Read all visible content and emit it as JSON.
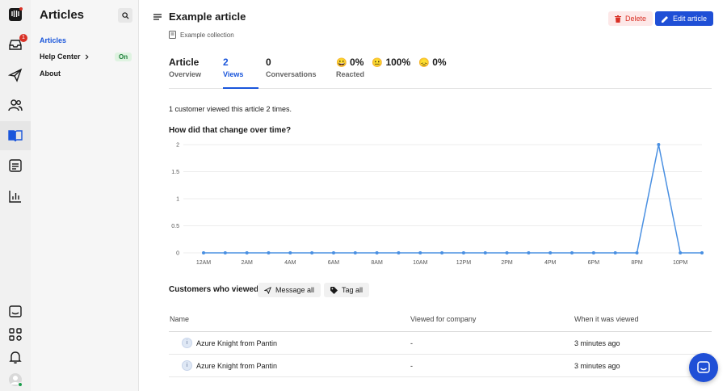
{
  "rail": {
    "inbox_badge": "1"
  },
  "subnav": {
    "title": "Articles",
    "items": [
      {
        "label": "Articles",
        "active": true
      },
      {
        "label": "Help Center",
        "status": "On"
      },
      {
        "label": "About"
      }
    ]
  },
  "article": {
    "title": "Example article",
    "collection": "Example collection",
    "delete_label": "Delete",
    "edit_label": "Edit article"
  },
  "tabs": [
    {
      "value": "Article",
      "label": "Overview"
    },
    {
      "value": "2",
      "label": "Views"
    },
    {
      "value": "0",
      "label": "Conversations"
    }
  ],
  "reactions": {
    "items": [
      {
        "emoji": "😀",
        "percent": "0%"
      },
      {
        "emoji": "😐",
        "percent": "100%"
      },
      {
        "emoji": "😞",
        "percent": "0%"
      }
    ],
    "label": "Reacted"
  },
  "summary": "1 customer viewed this article 2 times.",
  "chart_question": "How did that change over time?",
  "chart_data": {
    "type": "line",
    "x": [
      "12AM",
      "1AM",
      "2AM",
      "3AM",
      "4AM",
      "5AM",
      "6AM",
      "7AM",
      "8AM",
      "9AM",
      "10AM",
      "11AM",
      "12PM",
      "1PM",
      "2PM",
      "3PM",
      "4PM",
      "5PM",
      "6PM",
      "7PM",
      "8PM",
      "9PM",
      "10PM",
      "11PM"
    ],
    "x_tick_labels": [
      "12AM",
      "2AM",
      "4AM",
      "6AM",
      "8AM",
      "10AM",
      "12PM",
      "2PM",
      "4PM",
      "6PM",
      "8PM",
      "10PM"
    ],
    "y_tick_labels": [
      "2",
      "1.5",
      "1",
      "0.5",
      "0"
    ],
    "series": [
      {
        "values": [
          0,
          0,
          0,
          0,
          0,
          0,
          0,
          0,
          0,
          0,
          0,
          0,
          0,
          0,
          0,
          0,
          0,
          0,
          0,
          0,
          0,
          2,
          0,
          0
        ]
      }
    ],
    "ylim": [
      0,
      2
    ],
    "grid": true,
    "color": "#4a90e2"
  },
  "viewers": {
    "heading": "Customers who viewed",
    "message_all": "Message all",
    "tag_all": "Tag all",
    "columns": [
      "Name",
      "Viewed for company",
      "When it was viewed"
    ],
    "rows": [
      {
        "name": "Azure Knight from Pantin",
        "company": "-",
        "when": "3 minutes ago"
      },
      {
        "name": "Azure Knight from Pantin",
        "company": "-",
        "when": "3 minutes ago"
      }
    ]
  }
}
